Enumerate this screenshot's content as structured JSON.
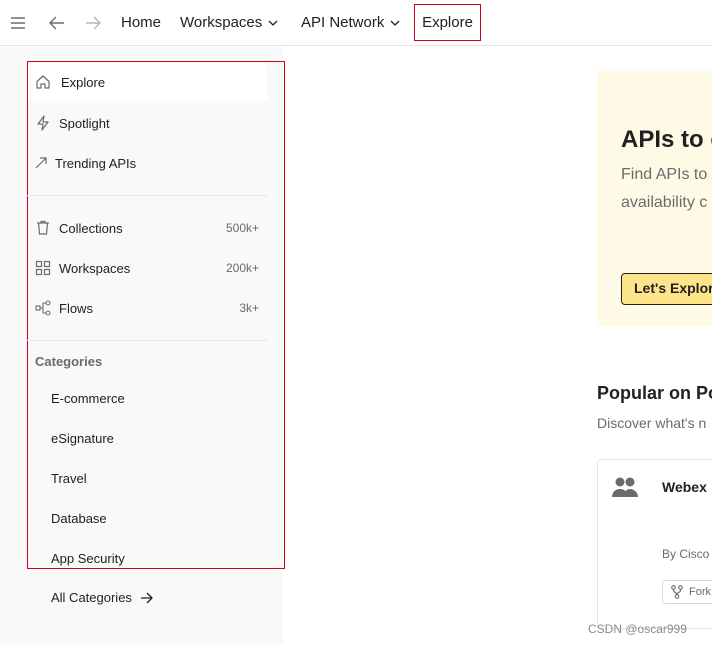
{
  "topbar": {
    "menu_icon": "hamburger-menu-icon",
    "back_icon": "arrow-left-icon",
    "forward_icon": "arrow-right-icon",
    "home": "Home",
    "workspaces": "Workspaces",
    "api_network": "API Network",
    "explore": "Explore"
  },
  "sidebar": {
    "explore_label": "Explore",
    "primary": [
      {
        "label": "Spotlight",
        "icon": "lightning-icon"
      },
      {
        "label": "Trending APIs",
        "icon": "trending-up-icon"
      }
    ],
    "entities": [
      {
        "label": "Collections",
        "count": "500k+",
        "icon": "trash-bin-icon"
      },
      {
        "label": "Workspaces",
        "count": "200k+",
        "icon": "grid-icon"
      },
      {
        "label": "Flows",
        "count": "3k+",
        "icon": "flows-icon"
      }
    ],
    "categories_heading": "Categories",
    "categories": [
      "E-commerce",
      "eSignature",
      "Travel",
      "Database",
      "App Security"
    ],
    "all_categories": "All Categories"
  },
  "hero": {
    "title": "APIs to c",
    "text_line1": "Find APIs to",
    "text_line2": "availability c",
    "button": "Let's Explor"
  },
  "popular": {
    "title": "Popular on Pos",
    "subtitle": "Discover what's n",
    "card": {
      "title": "Webex",
      "by": "By Cisco",
      "fork": "Fork"
    }
  },
  "watermark": "CSDN @oscar999",
  "colors": {
    "highlight_border": "#d0021b",
    "hero_bg": "#fffae6",
    "hero_button_bg": "#ffe58a",
    "sidebar_bg": "#f9f9f9"
  }
}
